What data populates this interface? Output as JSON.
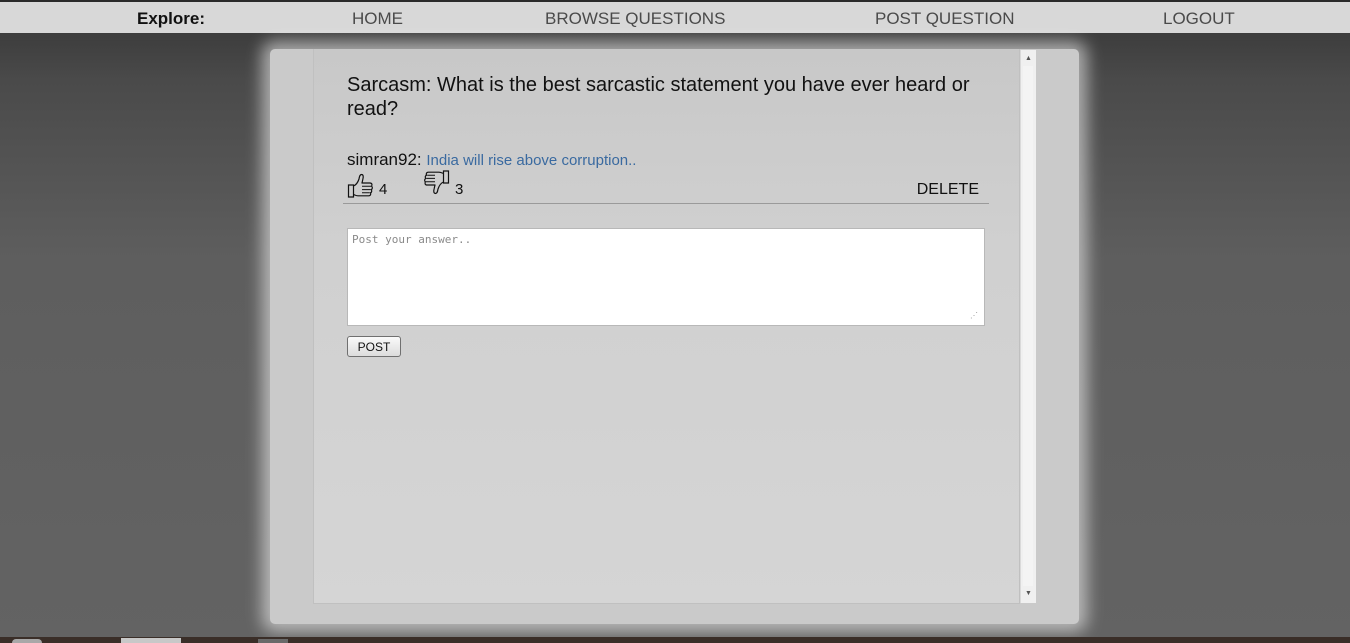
{
  "nav": {
    "brand": "Explore:",
    "home": "HOME",
    "browse": "BROWSE QUESTIONS",
    "post": "POST QUESTION",
    "logout": "LOGOUT"
  },
  "question": {
    "title": "Sarcasm: What is the best sarcastic statement you have ever heard or read?"
  },
  "answer": {
    "user": "simran92:",
    "text": "India will rise above corruption..",
    "upvotes": "4",
    "downvotes": "3",
    "delete_label": "DELETE",
    "upvote_icon": "thumbs-up-icon",
    "downvote_icon": "thumbs-down-icon"
  },
  "compose": {
    "placeholder": "Post your answer..",
    "value": "",
    "post_label": "POST"
  },
  "colors": {
    "answer_text": "#3a6aa0",
    "topbar_bg": "#d8d8d8",
    "panel_bg": "#cacaca"
  }
}
